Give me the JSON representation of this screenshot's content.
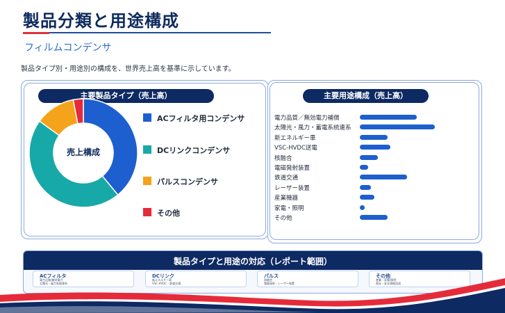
{
  "header": {
    "title": "製品分類と用途構成",
    "subtitle": "フィルムコンデンサ",
    "description": "製品タイプ別・用途別の構成を、世界売上高を基準に示しています。"
  },
  "product_panel": {
    "title": "主要製品タイプ（売上高）",
    "center_label": "売上構成"
  },
  "application_panel": {
    "title": "主要用途構成（売上高）"
  },
  "mapping_panel": {
    "title": "製品タイプと用途の対応（レポート範囲）",
    "cards": [
      {
        "title": "ACフィルタ",
        "lines": [
          "電力品質/無効電力",
          "太陽光・風力系統連系"
        ]
      },
      {
        "title": "DCリンク",
        "lines": [
          "新エネルギー車",
          "VSC-HVDC・鉄道交通"
        ]
      },
      {
        "title": "パルス",
        "lines": [
          "核融合",
          "電磁発射・レーザー装置"
        ]
      },
      {
        "title": "その他",
        "lines": [
          "産業・家電/照明",
          "既存・安全規格用途"
        ]
      }
    ]
  },
  "colors": {
    "navy": "#0e2a63",
    "blue": "#1d5fcf",
    "teal": "#17a9a8",
    "orange": "#f5a31a",
    "red": "#e52b3a"
  },
  "chart_data": [
    {
      "type": "pie",
      "title": "主要製品タイプ（売上高）",
      "categories": [
        "ACフィルタ用コンデンサ",
        "DCリンクコンデンサ",
        "パルスコンデンサ",
        "その他"
      ],
      "values": [
        39,
        46,
        12,
        3
      ],
      "colors": [
        "#1d5fcf",
        "#17a9a8",
        "#f5a31a",
        "#e52b3a"
      ],
      "legend": "right"
    },
    {
      "type": "bar",
      "orientation": "horizontal",
      "title": "主要用途構成（売上高）",
      "categories": [
        "電力品質／無効電力補償",
        "太陽光・風力・蓄電系統連系",
        "新エネルギー車",
        "VSC-HVDC送電",
        "核融合",
        "電磁発射装置",
        "鉄道交通",
        "レーザー装置",
        "産業機器",
        "家電・照明",
        "その他"
      ],
      "values": [
        17.5,
        23,
        8.5,
        9.5,
        5.5,
        2.5,
        14.5,
        3.5,
        4.5,
        1.2,
        8.5
      ],
      "xlim": [
        0,
        25
      ]
    }
  ]
}
